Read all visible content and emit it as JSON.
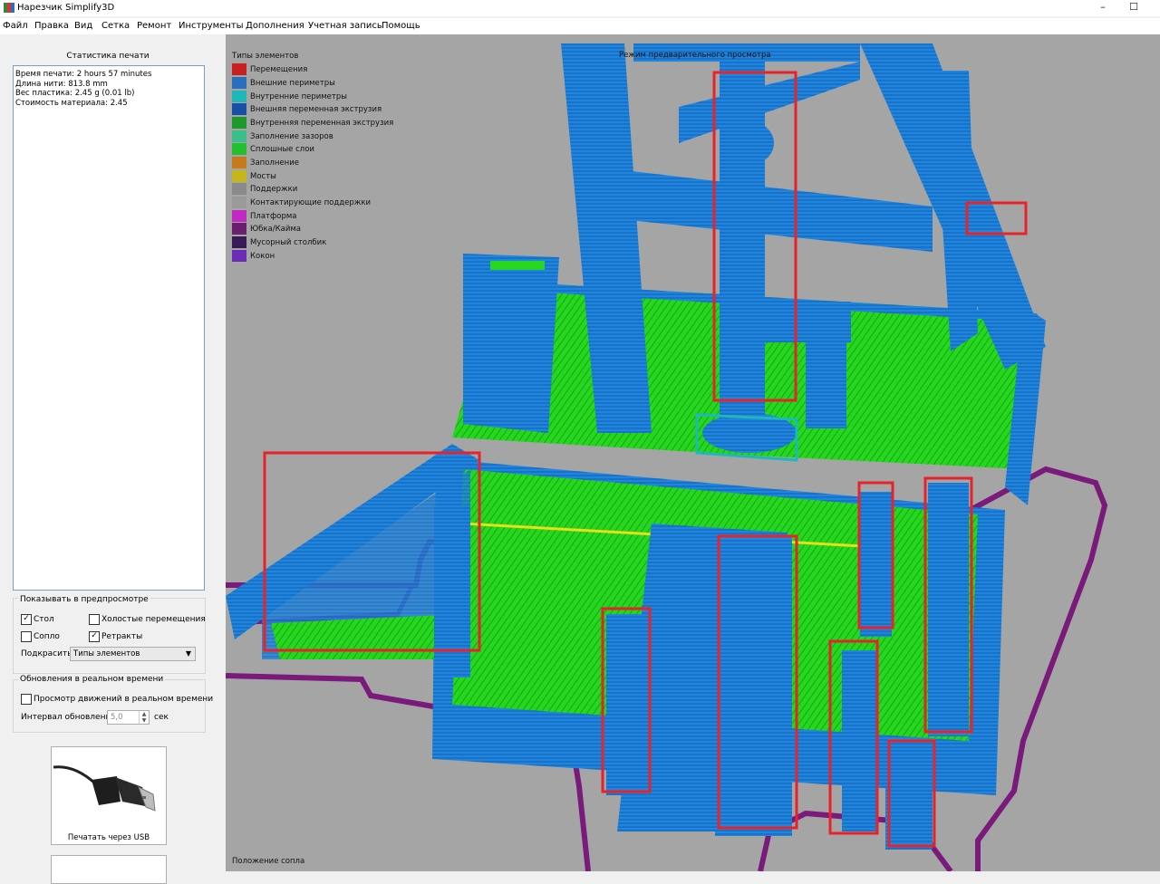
{
  "window": {
    "title": "Нарезчик Simplify3D",
    "minimize": "–",
    "maximize": "☐"
  },
  "menu": [
    "Файл",
    "Правка",
    "Вид",
    "Сетка",
    "Ремонт",
    "Инструменты",
    "Дополнения",
    "Учетная запись",
    "Помощь"
  ],
  "stats": {
    "title": "Статистика печати",
    "lines": [
      "Время печати: 2 hours 57 minutes",
      "Длина нити: 813.8 mm",
      "Вес пластика: 2.45 g (0.01 lb)",
      "Стоимость материала: 2.45"
    ]
  },
  "preview_options": {
    "title": "Показывать в предпросмотре",
    "bed_label": "Стол",
    "bed_checked": true,
    "idle_label": "Холостые перемещения",
    "idle_checked": false,
    "nozzle_label": "Сопло",
    "nozzle_checked": false,
    "retract_label": "Ретракты",
    "retract_checked": true,
    "color_label": "Подкрасить",
    "color_value": "Типы элементов"
  },
  "realtime": {
    "title": "Обновления в реальном времени",
    "view_label": "Просмотр движений в реальном времени",
    "view_checked": false,
    "interval_label": "Интервал обновления",
    "interval_value": "5,0",
    "interval_unit": "сек"
  },
  "usb": {
    "label": "Печатать через USB"
  },
  "viewport": {
    "mode_label": "Режим предварительного просмотра",
    "nozzle_position_label": "Положение сопла",
    "legend_title": "Типы элементов",
    "legend": [
      {
        "label": "Перемещения",
        "color": "#c8201e"
      },
      {
        "label": "Внешние периметры",
        "color": "#2a6fbd"
      },
      {
        "label": "Внутренние периметры",
        "color": "#1fb8b8"
      },
      {
        "label": "Внешняя переменная экструзия",
        "color": "#1a4fa8"
      },
      {
        "label": "Внутренняя переменная экструзия",
        "color": "#1e9a2c"
      },
      {
        "label": "Заполнение зазоров",
        "color": "#3bbf8a"
      },
      {
        "label": "Сплошные слои",
        "color": "#22c02e"
      },
      {
        "label": "Заполнение",
        "color": "#c77a1c"
      },
      {
        "label": "Мосты",
        "color": "#c7b51c"
      },
      {
        "label": "Поддержки",
        "color": "#8a8a8a"
      },
      {
        "label": "Контактирующие поддержки",
        "color": "#9a9a9a"
      },
      {
        "label": "Платформа",
        "color": "#c228c2"
      },
      {
        "label": "Юбка/Кайма",
        "color": "#6a1f6a"
      },
      {
        "label": "Мусорный столбик",
        "color": "#3a1a55"
      },
      {
        "label": "Кокон",
        "color": "#6c2cb8"
      }
    ]
  }
}
